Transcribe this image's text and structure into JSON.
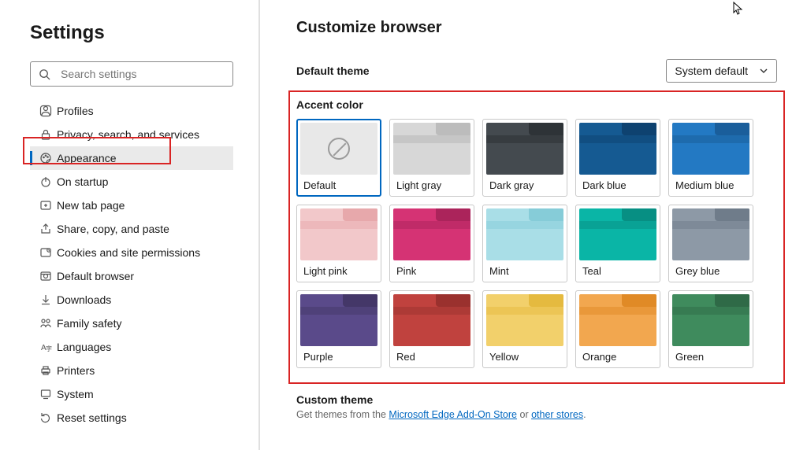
{
  "sidebar": {
    "title": "Settings",
    "search_placeholder": "Search settings",
    "items": [
      {
        "label": "Profiles"
      },
      {
        "label": "Privacy, search, and services"
      },
      {
        "label": "Appearance"
      },
      {
        "label": "On startup"
      },
      {
        "label": "New tab page"
      },
      {
        "label": "Share, copy, and paste"
      },
      {
        "label": "Cookies and site permissions"
      },
      {
        "label": "Default browser"
      },
      {
        "label": "Downloads"
      },
      {
        "label": "Family safety"
      },
      {
        "label": "Languages"
      },
      {
        "label": "Printers"
      },
      {
        "label": "System"
      },
      {
        "label": "Reset settings"
      }
    ],
    "active_index": 2
  },
  "main": {
    "heading": "Customize browser",
    "default_theme_label": "Default theme",
    "default_theme_value": "System default",
    "accent_label": "Accent color",
    "swatches": [
      {
        "label": "Default",
        "type": "default"
      },
      {
        "label": "Light gray",
        "bg": "#d7d7d7",
        "tab": "#bcbcbc",
        "bar": "#c6c6c6"
      },
      {
        "label": "Dark gray",
        "bg": "#444a4f",
        "tab": "#2e3337",
        "bar": "#373c40"
      },
      {
        "label": "Dark blue",
        "bg": "#155a92",
        "tab": "#0e4270",
        "bar": "#114e81"
      },
      {
        "label": "Medium blue",
        "bg": "#2379c3",
        "tab": "#1a5e9b",
        "bar": "#1e6bad"
      },
      {
        "label": "Light pink",
        "bg": "#f2c8ca",
        "tab": "#e7a8ab",
        "bar": "#edb8bb"
      },
      {
        "label": "Pink",
        "bg": "#d53374",
        "tab": "#ab245b",
        "bar": "#c02b68"
      },
      {
        "label": "Mint",
        "bg": "#a9dee7",
        "tab": "#86ccd8",
        "bar": "#97d5e0"
      },
      {
        "label": "Teal",
        "bg": "#0ab5a6",
        "tab": "#078f83",
        "bar": "#09a295"
      },
      {
        "label": "Grey blue",
        "bg": "#8d99a6",
        "tab": "#6f7c8a",
        "bar": "#7e8a98"
      },
      {
        "label": "Purple",
        "bg": "#5a4a8a",
        "tab": "#443768",
        "bar": "#4f4179"
      },
      {
        "label": "Red",
        "bg": "#c0423e",
        "tab": "#9a312e",
        "bar": "#ad3a36"
      },
      {
        "label": "Yellow",
        "bg": "#f2d06b",
        "tab": "#e5ba3f",
        "bar": "#ecc555"
      },
      {
        "label": "Orange",
        "bg": "#f2a74f",
        "tab": "#e08a26",
        "bar": "#e9983a"
      },
      {
        "label": "Green",
        "bg": "#3f8b5d",
        "tab": "#2f6a47",
        "bar": "#377b52"
      }
    ],
    "selected_swatch": 0,
    "custom_theme": {
      "title": "Custom theme",
      "prefix": "Get themes from the ",
      "link1": "Microsoft Edge Add-On Store",
      "mid": " or ",
      "link2": "other stores",
      "suffix": "."
    }
  }
}
